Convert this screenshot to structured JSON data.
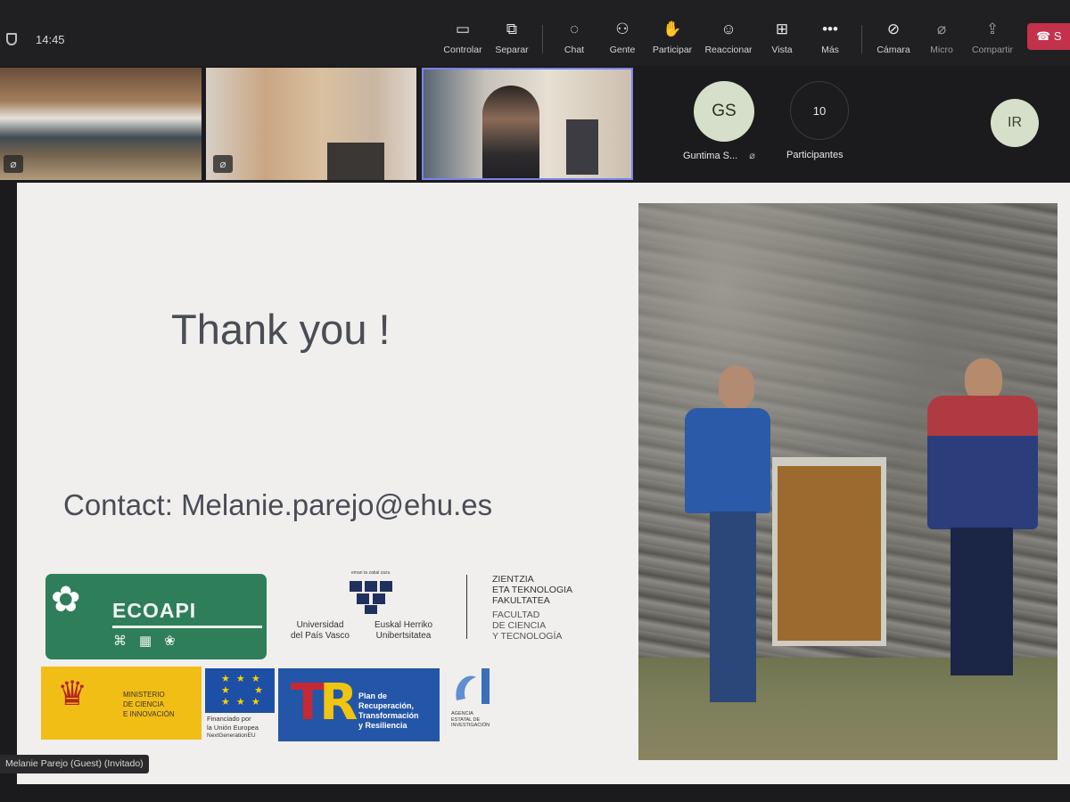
{
  "status": {
    "time": "14:45"
  },
  "toolbar": {
    "controlar": "Controlar",
    "separar": "Separar",
    "chat": "Chat",
    "gente": "Gente",
    "participar": "Participar",
    "reaccionar": "Reaccionar",
    "vista": "Vista",
    "mas": "Más",
    "camara": "Cámara",
    "micro": "Micro",
    "compartir": "Compartir",
    "leave_label": "S"
  },
  "participants": {
    "gs_initials": "GS",
    "gs_name": "Guntima S...",
    "count": "10",
    "count_label": "Participantes",
    "ir_initials": "IR"
  },
  "slide": {
    "title": "Thank you !",
    "contact": "Contact: Melanie.parejo@ehu.es",
    "ecoapi": "ECOAPI",
    "upv_es": "Universidad\ndel País Vasco",
    "upv_eu": "Euskal Herriko\nUnibertsitatea",
    "upv_motto": "eman ta zabal zazu",
    "fac_eu": [
      "ZIENTZIA",
      "ETA TEKNOLOGIA",
      "FAKULTATEA"
    ],
    "fac_es": [
      "FACULTAD",
      "DE CIENCIA",
      "Y TECNOLOGÍA"
    ],
    "ministerio": [
      "MINISTERIO",
      "DE CIENCIA",
      "E INNOVACIÓN"
    ],
    "eu_caption": [
      "Financiado por",
      "la Unión Europea",
      "NextGenerationEU"
    ],
    "plan": [
      "Plan de",
      "Recuperación,",
      "Transformación",
      "y Resiliencia"
    ],
    "aei": [
      "AGENCIA",
      "ESTATAL DE",
      "INVESTIGACIÓN"
    ]
  },
  "presenter": {
    "name": "Melanie Parejo (Guest) (Invitado)"
  },
  "colors": {
    "accent": "#7b83eb",
    "leave": "#c4314b",
    "ecoapi_green": "#2f7e5a"
  }
}
